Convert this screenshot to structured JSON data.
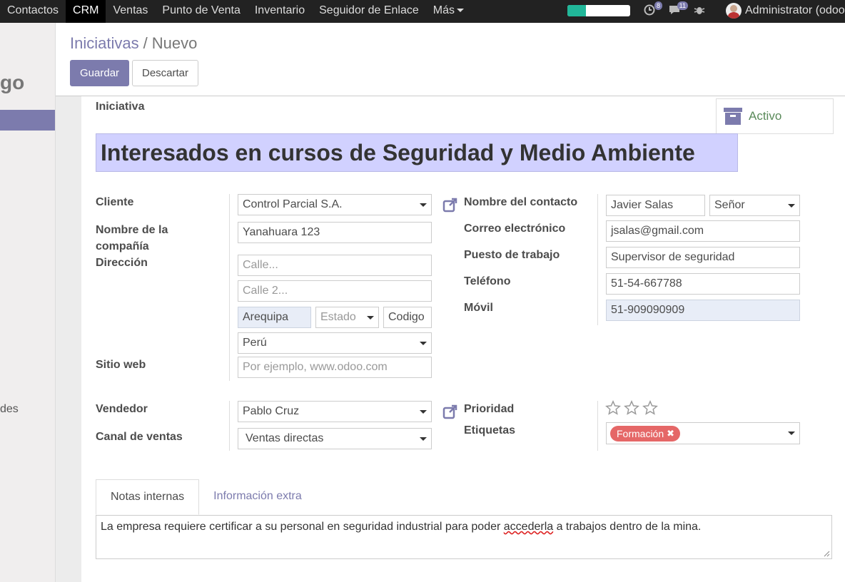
{
  "topnav": {
    "items": [
      "Contactos",
      "CRM",
      "Ventas",
      "Punto de Venta",
      "Inventario",
      "Seguidor de Enlace",
      "Más"
    ],
    "active_index": 1,
    "progress_fraction": 0.3,
    "activity_count": "8",
    "messages_count": "11",
    "user_name": "Administrator (odoo"
  },
  "sidebar": {
    "logo_fragment": "go",
    "item_fragment": "des"
  },
  "breadcrumb": {
    "parent": "Iniciativas",
    "separator": "/",
    "current": "Nuevo"
  },
  "buttons": {
    "save": "Guardar",
    "discard": "Descartar"
  },
  "form": {
    "header_label": "Iniciativa",
    "status": "Activo",
    "title": "Interesados en cursos de Seguridad y Medio Ambiente",
    "left": {
      "cliente_label": "Cliente",
      "cliente_value": "Control Parcial S.A.",
      "compania_label_1": "Nombre de la",
      "compania_label_2": "compañía",
      "compania_value": "Yanahuara 123",
      "direccion_label": "Dirección",
      "calle_placeholder": "Calle...",
      "calle2_placeholder": "Calle 2...",
      "ciudad_value": "Arequipa",
      "estado_placeholder": "Estado",
      "codigo_value": "Codigo",
      "pais_value": "Perú",
      "web_label": "Sitio web",
      "web_placeholder": "Por ejemplo, www.odoo.com"
    },
    "right": {
      "contacto_label": "Nombre del contacto",
      "contacto_value": "Javier Salas",
      "titulo_value": "Señor",
      "correo_label": "Correo electrónico",
      "correo_value": "jsalas@gmail.com",
      "puesto_label": "Puesto de trabajo",
      "puesto_value": "Supervisor de seguridad",
      "telefono_label": "Teléfono",
      "telefono_value": "51-54-667788",
      "movil_label": "Móvil",
      "movil_value": "51-909090909"
    },
    "sales": {
      "vendedor_label": "Vendedor",
      "vendedor_value": "Pablo Cruz",
      "canal_label": "Canal de ventas",
      "canal_value": "Ventas directas",
      "prioridad_label": "Prioridad",
      "prioridad_stars": 3,
      "etiquetas_label": "Etiquetas",
      "tag": "Formación"
    },
    "tabs": [
      "Notas internas",
      "Información extra"
    ],
    "notes_before": "La empresa requiere certificar a su personal en seguridad industrial para poder ",
    "notes_misspelled": "accederla",
    "notes_after": " a trabajos dentro de la mina."
  },
  "colors": {
    "brand": "#7c7bad",
    "title_bg": "#d1d1ff",
    "tag": "#e56767",
    "progress": "#21b799"
  }
}
